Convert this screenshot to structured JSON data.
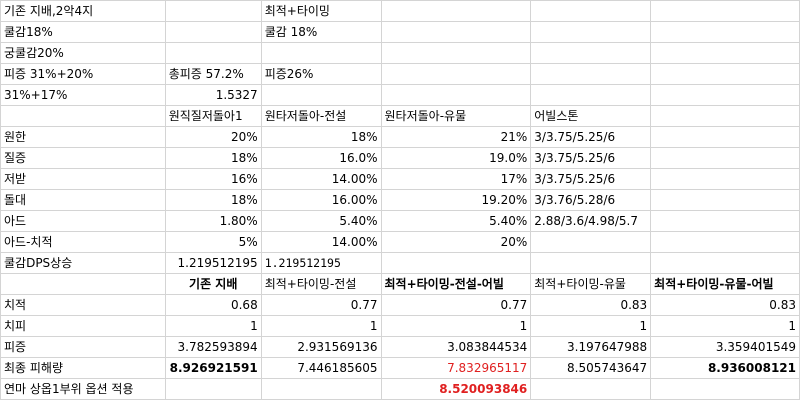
{
  "sheet": {
    "rows": [
      [
        "기존 지배,2악4지",
        "",
        "최적+타이밍",
        "",
        "",
        ""
      ],
      [
        "쿨감18%",
        "",
        "쿨감 18%",
        "",
        "",
        ""
      ],
      [
        "궁쿨감20%",
        "",
        "",
        "",
        "",
        ""
      ],
      [
        "피증 31%+20%",
        "총피증 57.2%",
        "피증26%",
        "",
        "",
        ""
      ],
      [
        "31%+17%",
        "1.5327",
        "",
        "",
        "",
        ""
      ],
      [
        "",
        "원직질저돌아1",
        "원타저돌아-전설",
        "원타저돌아-유물",
        "어빌스톤",
        ""
      ],
      [
        "원한",
        "20%",
        "18%",
        "21%",
        "3/3.75/5.25/6",
        ""
      ],
      [
        "질증",
        "18%",
        "16.0%",
        "19.0%",
        "3/3.75/5.25/6",
        ""
      ],
      [
        "저받",
        "16%",
        "14.00%",
        "17%",
        "3/3.75/5.25/6",
        ""
      ],
      [
        "돌대",
        "18%",
        "16.00%",
        "19.20%",
        "3/3.76/5.28/6",
        ""
      ],
      [
        "아드",
        "1.80%",
        "5.40%",
        "5.40%",
        "2.88/3.6/4.98/5.7",
        ""
      ],
      [
        "아드-치적",
        "5%",
        "14.00%",
        "20%",
        "",
        ""
      ],
      [
        "쿨감DPS상승",
        "1.219512195",
        "1.219512195",
        "",
        "",
        ""
      ],
      [
        "",
        "기존 지배",
        "최적+타이밍-전설",
        "최적+타이밍-전설-어빌",
        "최적+타이밍-유물",
        "최적+타이밍-유물-어빌"
      ],
      [
        "치적",
        "0.68",
        "0.77",
        "0.77",
        "0.83",
        "0.83"
      ],
      [
        "치피",
        "1",
        "1",
        "1",
        "1",
        "1"
      ],
      [
        "피증",
        "3.782593894",
        "2.931569136",
        "3.083844534",
        "3.197647988",
        "3.359401549"
      ],
      [
        "최종 피해량",
        "8.926921591",
        "7.446185605",
        "7.832965117",
        "8.505743647",
        "8.936008121"
      ],
      [
        "연마 상옵1부위 옵션 적용",
        "",
        "",
        "8.520093846",
        "",
        ""
      ]
    ]
  }
}
